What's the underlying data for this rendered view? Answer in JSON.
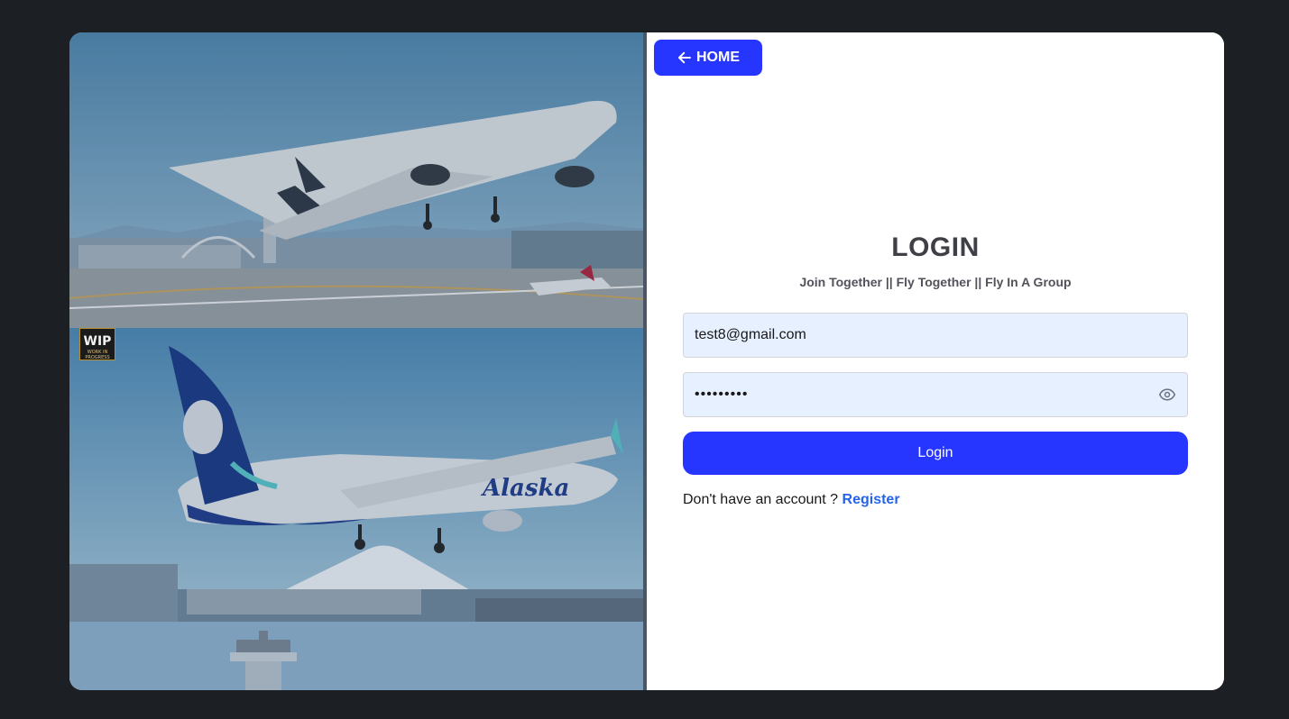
{
  "home_button": {
    "label": "HOME",
    "icon": "arrow-left-icon"
  },
  "login": {
    "title": "LOGIN",
    "tagline": "Join Together || Fly Together || Fly In A Group",
    "email_value": "test8@gmail.com",
    "password_masked": "•••••••••",
    "password_toggle_icon": "eye-icon",
    "submit_label": "Login",
    "register_prompt": "Don't have an account ?",
    "register_link": "Register"
  },
  "gallery": {
    "badge_main": "WIP",
    "badge_sub": "WORK IN PROGRESS",
    "airline_livery": "Alaska"
  },
  "colors": {
    "accent": "#2636ff",
    "link": "#2563eb",
    "page_background": "#1c1f24",
    "input_background": "#e7f0fe"
  }
}
